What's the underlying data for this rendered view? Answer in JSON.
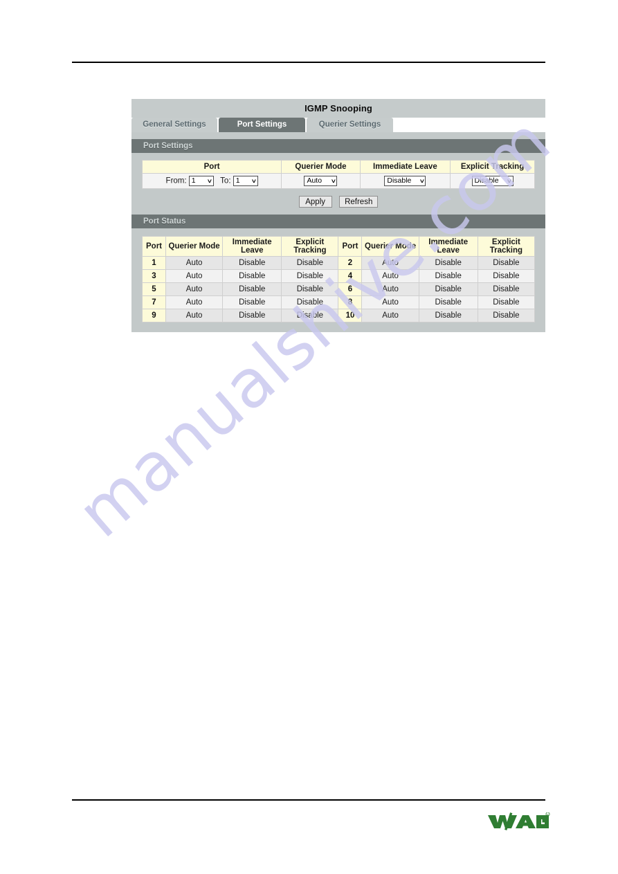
{
  "page": {
    "watermark": "manualshive.com"
  },
  "app": {
    "title": "IGMP Snooping",
    "tabs": [
      {
        "label": "General Settings",
        "active": false
      },
      {
        "label": "Port Settings",
        "active": true
      },
      {
        "label": "Querier Settings",
        "active": false
      }
    ]
  },
  "port_settings": {
    "section_title": "Port Settings",
    "headers": [
      "Port",
      "Querier Mode",
      "Immediate Leave",
      "Explicit Tracking"
    ],
    "from_label": "From:",
    "to_label": "To:",
    "from_value": "1",
    "to_value": "1",
    "querier_mode_value": "Auto",
    "immediate_leave_value": "Disable",
    "explicit_tracking_value": "Disable",
    "apply_label": "Apply",
    "refresh_label": "Refresh"
  },
  "port_status": {
    "section_title": "Port Status",
    "headers": [
      "Port",
      "Querier Mode",
      "Immediate Leave",
      "Explicit Tracking",
      "Port",
      "Querier Mode",
      "Immediate Leave",
      "Explicit Tracking"
    ],
    "rows": [
      {
        "left_port": "1",
        "left_querier": "Auto",
        "left_immediate": "Disable",
        "left_explicit": "Disable",
        "right_port": "2",
        "right_querier": "Auto",
        "right_immediate": "Disable",
        "right_explicit": "Disable"
      },
      {
        "left_port": "3",
        "left_querier": "Auto",
        "left_immediate": "Disable",
        "left_explicit": "Disable",
        "right_port": "4",
        "right_querier": "Auto",
        "right_immediate": "Disable",
        "right_explicit": "Disable"
      },
      {
        "left_port": "5",
        "left_querier": "Auto",
        "left_immediate": "Disable",
        "left_explicit": "Disable",
        "right_port": "6",
        "right_querier": "Auto",
        "right_immediate": "Disable",
        "right_explicit": "Disable"
      },
      {
        "left_port": "7",
        "left_querier": "Auto",
        "left_immediate": "Disable",
        "left_explicit": "Disable",
        "right_port": "8",
        "right_querier": "Auto",
        "right_immediate": "Disable",
        "right_explicit": "Disable"
      },
      {
        "left_port": "9",
        "left_querier": "Auto",
        "left_immediate": "Disable",
        "left_explicit": "Disable",
        "right_port": "10",
        "right_querier": "Auto",
        "right_immediate": "Disable",
        "right_explicit": "Disable"
      }
    ]
  },
  "footer": {
    "logo_text": "WAGO",
    "logo_registered": "®",
    "logo_color": "#2f7d32"
  },
  "icons": {
    "caret_down": "∨"
  }
}
